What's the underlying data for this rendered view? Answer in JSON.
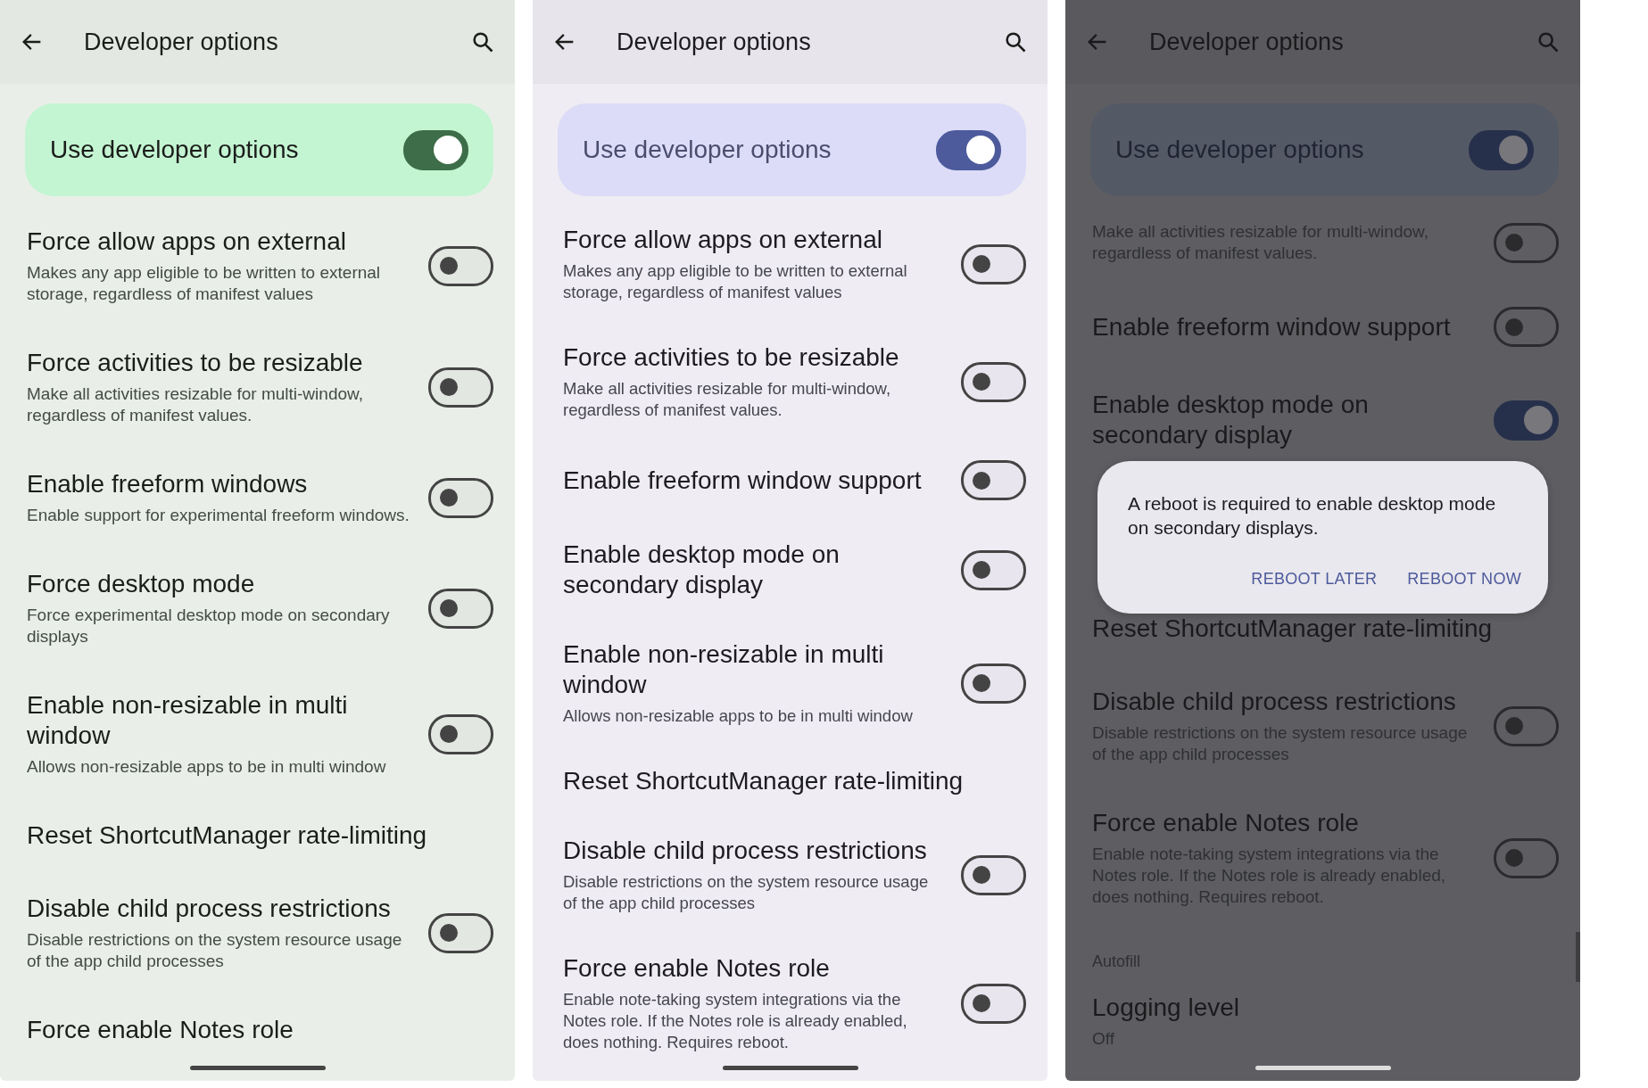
{
  "panels": [
    {
      "kind": "green",
      "title": "Developer options",
      "master": {
        "label": "Use developer options",
        "on": true
      },
      "items": [
        {
          "kind": "switch",
          "title": "Force allow apps on external",
          "summary": "Makes any app eligible to be written to external storage, regardless of manifest values",
          "on": false
        },
        {
          "kind": "switch",
          "title": "Force activities to be resizable",
          "summary": "Make all activities resizable for multi-window, regardless of manifest values.",
          "on": false
        },
        {
          "kind": "switch",
          "title": "Enable freeform windows",
          "summary": "Enable support for experimental freeform windows.",
          "on": false
        },
        {
          "kind": "switch",
          "title": "Force desktop mode",
          "summary": "Force experimental desktop mode on secondary displays",
          "on": false
        },
        {
          "kind": "switch",
          "title": "Enable non-resizable in multi window",
          "summary": "Allows non-resizable apps to be in multi window",
          "on": false
        },
        {
          "kind": "action",
          "title": "Reset ShortcutManager rate-limiting"
        },
        {
          "kind": "switch",
          "title": "Disable child process restrictions",
          "summary": "Disable restrictions on the system resource usage of the app child processes",
          "on": false
        },
        {
          "kind": "action",
          "title": "Force enable Notes role"
        }
      ]
    },
    {
      "kind": "purple",
      "title": "Developer options",
      "master": {
        "label": "Use developer options",
        "on": true
      },
      "items": [
        {
          "kind": "switch",
          "title": "Force allow apps on external",
          "summary": "Makes any app eligible to be written to external storage, regardless of manifest values",
          "on": false
        },
        {
          "kind": "switch",
          "title": "Force activities to be resizable",
          "summary": "Make all activities resizable for multi-window, regardless of manifest values.",
          "on": false
        },
        {
          "kind": "switch",
          "title": "Enable freeform window support",
          "on": false
        },
        {
          "kind": "switch",
          "title": "Enable desktop mode on secondary display",
          "on": false
        },
        {
          "kind": "switch",
          "title": "Enable non-resizable in multi window",
          "summary": "Allows non-resizable apps to be in multi window",
          "on": false
        },
        {
          "kind": "action",
          "title": "Reset ShortcutManager rate-limiting"
        },
        {
          "kind": "switch",
          "title": "Disable child process restrictions",
          "summary": "Disable restrictions on the system resource usage of the app child processes",
          "on": false
        },
        {
          "kind": "switch",
          "title": "Force enable Notes role",
          "summary": "Enable note-taking system integrations via the Notes role. If the Notes role is already enabled, does nothing. Requires reboot.",
          "on": false
        }
      ]
    },
    {
      "kind": "dim",
      "title": "Developer options",
      "master": {
        "label": "Use developer options",
        "on": true
      },
      "items": [
        {
          "kind": "switch",
          "summary": "Make all activities resizable for multi-window, regardless of manifest values.",
          "on": false
        },
        {
          "kind": "switch",
          "title": "Enable freeform window support",
          "on": false
        },
        {
          "kind": "switch",
          "title": "Enable desktop mode on secondary display",
          "on": true
        },
        {
          "kind": "dialog",
          "message": "A reboot is required to enable desktop mode on secondary displays.",
          "buttons": [
            "REBOOT LATER",
            "REBOOT NOW"
          ]
        },
        {
          "kind": "action",
          "title": "Reset ShortcutManager rate-limiting"
        },
        {
          "kind": "switch",
          "title": "Disable child process restrictions",
          "summary": "Disable restrictions on the system resource usage of the app child processes",
          "on": false
        },
        {
          "kind": "switch",
          "title": "Force enable Notes role",
          "summary": "Enable note-taking system integrations via the Notes role. If the Notes role is already enabled, does nothing. Requires reboot.",
          "on": false
        },
        {
          "kind": "header",
          "title": "Autofill"
        },
        {
          "kind": "value",
          "title": "Logging level",
          "summary": "Off"
        }
      ]
    }
  ]
}
